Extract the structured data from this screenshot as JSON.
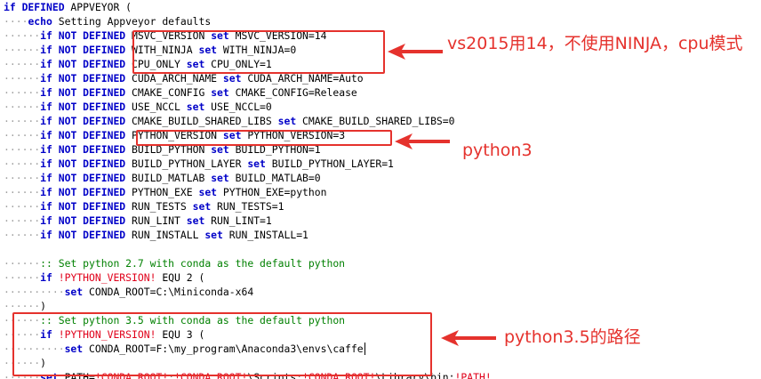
{
  "code_lines": [
    {
      "indent": "",
      "parts": [
        {
          "t": "kw",
          "v": "if DEFINED"
        },
        {
          "t": "txt",
          "v": " APPVEYOR ("
        }
      ]
    },
    {
      "indent": "····",
      "parts": [
        {
          "t": "kw",
          "v": "echo"
        },
        {
          "t": "txt",
          "v": " Setting Appveyor defaults"
        }
      ]
    },
    {
      "indent": "······",
      "parts": [
        {
          "t": "kw",
          "v": "if NOT DEFINED"
        },
        {
          "t": "txt",
          "v": " MSVC_VERSION "
        },
        {
          "t": "kw",
          "v": "set"
        },
        {
          "t": "txt",
          "v": " MSVC_VERSION=14"
        }
      ]
    },
    {
      "indent": "······",
      "parts": [
        {
          "t": "kw",
          "v": "if NOT DEFINED"
        },
        {
          "t": "txt",
          "v": " WITH_NINJA "
        },
        {
          "t": "kw",
          "v": "set"
        },
        {
          "t": "txt",
          "v": " WITH_NINJA=0"
        }
      ]
    },
    {
      "indent": "······",
      "parts": [
        {
          "t": "kw",
          "v": "if NOT DEFINED"
        },
        {
          "t": "txt",
          "v": " CPU_ONLY "
        },
        {
          "t": "kw",
          "v": "set"
        },
        {
          "t": "txt",
          "v": " CPU_ONLY=1"
        }
      ]
    },
    {
      "indent": "······",
      "parts": [
        {
          "t": "kw",
          "v": "if NOT DEFINED"
        },
        {
          "t": "txt",
          "v": " CUDA_ARCH_NAME "
        },
        {
          "t": "kw",
          "v": "set"
        },
        {
          "t": "txt",
          "v": " CUDA_ARCH_NAME=Auto"
        }
      ]
    },
    {
      "indent": "······",
      "parts": [
        {
          "t": "kw",
          "v": "if NOT DEFINED"
        },
        {
          "t": "txt",
          "v": " CMAKE_CONFIG "
        },
        {
          "t": "kw",
          "v": "set"
        },
        {
          "t": "txt",
          "v": " CMAKE_CONFIG=Release"
        }
      ]
    },
    {
      "indent": "······",
      "parts": [
        {
          "t": "kw",
          "v": "if NOT DEFINED"
        },
        {
          "t": "txt",
          "v": " USE_NCCL "
        },
        {
          "t": "kw",
          "v": "set"
        },
        {
          "t": "txt",
          "v": " USE_NCCL=0"
        }
      ]
    },
    {
      "indent": "······",
      "parts": [
        {
          "t": "kw",
          "v": "if NOT DEFINED"
        },
        {
          "t": "txt",
          "v": " CMAKE_BUILD_SHARED_LIBS "
        },
        {
          "t": "kw",
          "v": "set"
        },
        {
          "t": "txt",
          "v": " CMAKE_BUILD_SHARED_LIBS=0"
        }
      ]
    },
    {
      "indent": "······",
      "parts": [
        {
          "t": "kw",
          "v": "if NOT DEFINED"
        },
        {
          "t": "txt",
          "v": " PYTHON_VERSION "
        },
        {
          "t": "kw",
          "v": "set"
        },
        {
          "t": "txt",
          "v": " PYTHON_VERSION=3"
        }
      ]
    },
    {
      "indent": "······",
      "parts": [
        {
          "t": "kw",
          "v": "if NOT DEFINED"
        },
        {
          "t": "txt",
          "v": " BUILD_PYTHON "
        },
        {
          "t": "kw",
          "v": "set"
        },
        {
          "t": "txt",
          "v": " BUILD_PYTHON=1"
        }
      ]
    },
    {
      "indent": "······",
      "parts": [
        {
          "t": "kw",
          "v": "if NOT DEFINED"
        },
        {
          "t": "txt",
          "v": " BUILD_PYTHON_LAYER "
        },
        {
          "t": "kw",
          "v": "set"
        },
        {
          "t": "txt",
          "v": " BUILD_PYTHON_LAYER=1"
        }
      ]
    },
    {
      "indent": "······",
      "parts": [
        {
          "t": "kw",
          "v": "if NOT DEFINED"
        },
        {
          "t": "txt",
          "v": " BUILD_MATLAB "
        },
        {
          "t": "kw",
          "v": "set"
        },
        {
          "t": "txt",
          "v": " BUILD_MATLAB=0"
        }
      ]
    },
    {
      "indent": "······",
      "parts": [
        {
          "t": "kw",
          "v": "if NOT DEFINED"
        },
        {
          "t": "txt",
          "v": " PYTHON_EXE "
        },
        {
          "t": "kw",
          "v": "set"
        },
        {
          "t": "txt",
          "v": " PYTHON_EXE=python"
        }
      ]
    },
    {
      "indent": "······",
      "parts": [
        {
          "t": "kw",
          "v": "if NOT DEFINED"
        },
        {
          "t": "txt",
          "v": " RUN_TESTS "
        },
        {
          "t": "kw",
          "v": "set"
        },
        {
          "t": "txt",
          "v": " RUN_TESTS=1"
        }
      ]
    },
    {
      "indent": "······",
      "parts": [
        {
          "t": "kw",
          "v": "if NOT DEFINED"
        },
        {
          "t": "txt",
          "v": " RUN_LINT "
        },
        {
          "t": "kw",
          "v": "set"
        },
        {
          "t": "txt",
          "v": " RUN_LINT=1"
        }
      ]
    },
    {
      "indent": "······",
      "parts": [
        {
          "t": "kw",
          "v": "if NOT DEFINED"
        },
        {
          "t": "txt",
          "v": " RUN_INSTALL "
        },
        {
          "t": "kw",
          "v": "set"
        },
        {
          "t": "txt",
          "v": " RUN_INSTALL=1"
        }
      ]
    },
    {
      "indent": "",
      "parts": []
    },
    {
      "indent": "······",
      "parts": [
        {
          "t": "cmt",
          "v": ":: Set python 2.7 with conda as the default python"
        }
      ]
    },
    {
      "indent": "······",
      "parts": [
        {
          "t": "kw",
          "v": "if"
        },
        {
          "t": "txt",
          "v": " "
        },
        {
          "t": "var",
          "v": "!PYTHON_VERSION!"
        },
        {
          "t": "txt",
          "v": " EQU 2 ("
        }
      ]
    },
    {
      "indent": "··········",
      "parts": [
        {
          "t": "kw",
          "v": "set"
        },
        {
          "t": "txt",
          "v": " CONDA_ROOT=C:\\Miniconda-x64"
        }
      ]
    },
    {
      "indent": "······",
      "parts": [
        {
          "t": "txt",
          "v": ")"
        }
      ]
    },
    {
      "indent": "······",
      "parts": [
        {
          "t": "cmt",
          "v": ":: Set python 3.5 with conda as the default python"
        }
      ]
    },
    {
      "indent": "······",
      "parts": [
        {
          "t": "kw",
          "v": "if"
        },
        {
          "t": "txt",
          "v": " "
        },
        {
          "t": "var",
          "v": "!PYTHON_VERSION!"
        },
        {
          "t": "txt",
          "v": " EQU 3 ("
        }
      ]
    },
    {
      "indent": "··········",
      "parts": [
        {
          "t": "kw",
          "v": "set"
        },
        {
          "t": "txt",
          "v": " CONDA_ROOT=F:\\my_program\\Anaconda3\\envs\\caffe"
        },
        {
          "t": "cursor",
          "v": ""
        }
      ]
    },
    {
      "indent": "······",
      "parts": [
        {
          "t": "txt",
          "v": ")"
        }
      ]
    },
    {
      "indent": "······",
      "parts": [
        {
          "t": "kw",
          "v": "set"
        },
        {
          "t": "txt",
          "v": " PATH="
        },
        {
          "t": "var",
          "v": "!CONDA_ROOT!"
        },
        {
          "t": "txt",
          "v": ";"
        },
        {
          "t": "var",
          "v": "!CONDA_ROOT!"
        },
        {
          "t": "txt",
          "v": "\\Scripts;"
        },
        {
          "t": "var",
          "v": "!CONDA_ROOT!"
        },
        {
          "t": "txt",
          "v": "\\Library\\bin;"
        },
        {
          "t": "var",
          "v": "!PATH!"
        }
      ]
    }
  ],
  "annotations": [
    {
      "text": "vs2015用14，不使用NINJA，cpu模式"
    },
    {
      "text": "python3"
    },
    {
      "text": "python3.5的路径"
    }
  ],
  "colors": {
    "keyword": "#0000c8",
    "comment": "#008000",
    "variable": "#e0001a",
    "annotation": "#e5322d",
    "indent_dots": "#a0a0a0"
  }
}
